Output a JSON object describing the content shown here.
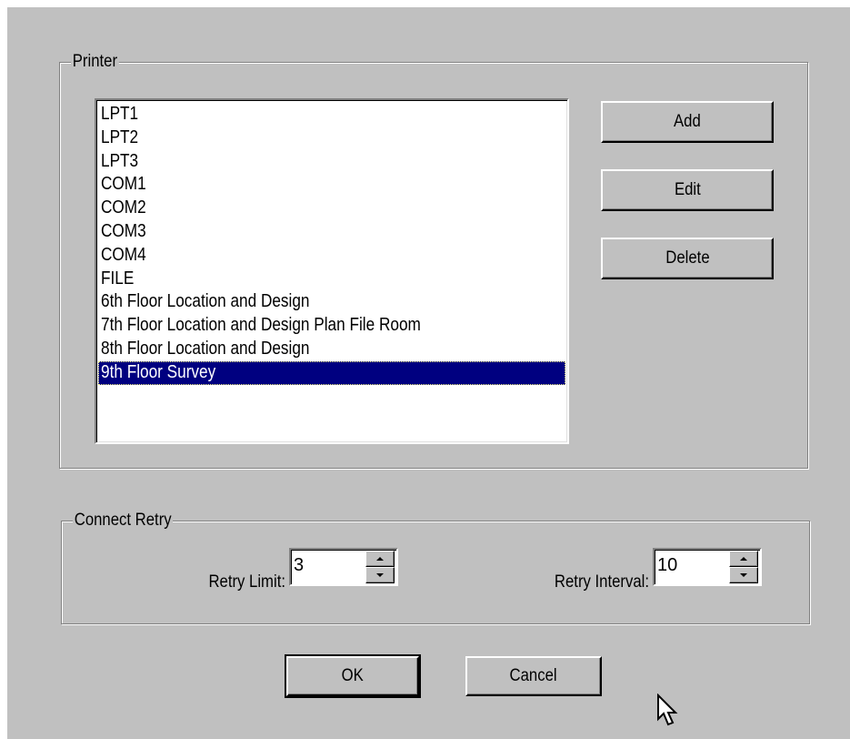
{
  "printer_group": {
    "title": "Printer",
    "ports": [
      "LPT1",
      "LPT2",
      "LPT3",
      "COM1",
      "COM2",
      "COM3",
      "COM4",
      "FILE",
      "6th Floor Location and Design",
      "7th Floor Location and Design Plan File Room",
      "8th Floor Location and Design",
      "9th Floor Survey"
    ],
    "selected_index": 11,
    "add_label": "Add",
    "edit_label": "Edit",
    "delete_label": "Delete"
  },
  "connect_retry_group": {
    "title": "Connect Retry",
    "retry_limit_label": "Retry Limit:",
    "retry_limit_value": "3",
    "retry_interval_label": "Retry Interval:",
    "retry_interval_value": "10"
  },
  "buttons": {
    "ok_label": "OK",
    "cancel_label": "Cancel"
  },
  "colors": {
    "dialog_bg": "#c0c0c0",
    "selection_bg": "#000080",
    "selection_text": "#ffffff"
  },
  "icons": {
    "spin_up": "spin-up-arrow-icon",
    "spin_down": "spin-down-arrow-icon",
    "mouse_pointer": "mouse-pointer-icon"
  }
}
